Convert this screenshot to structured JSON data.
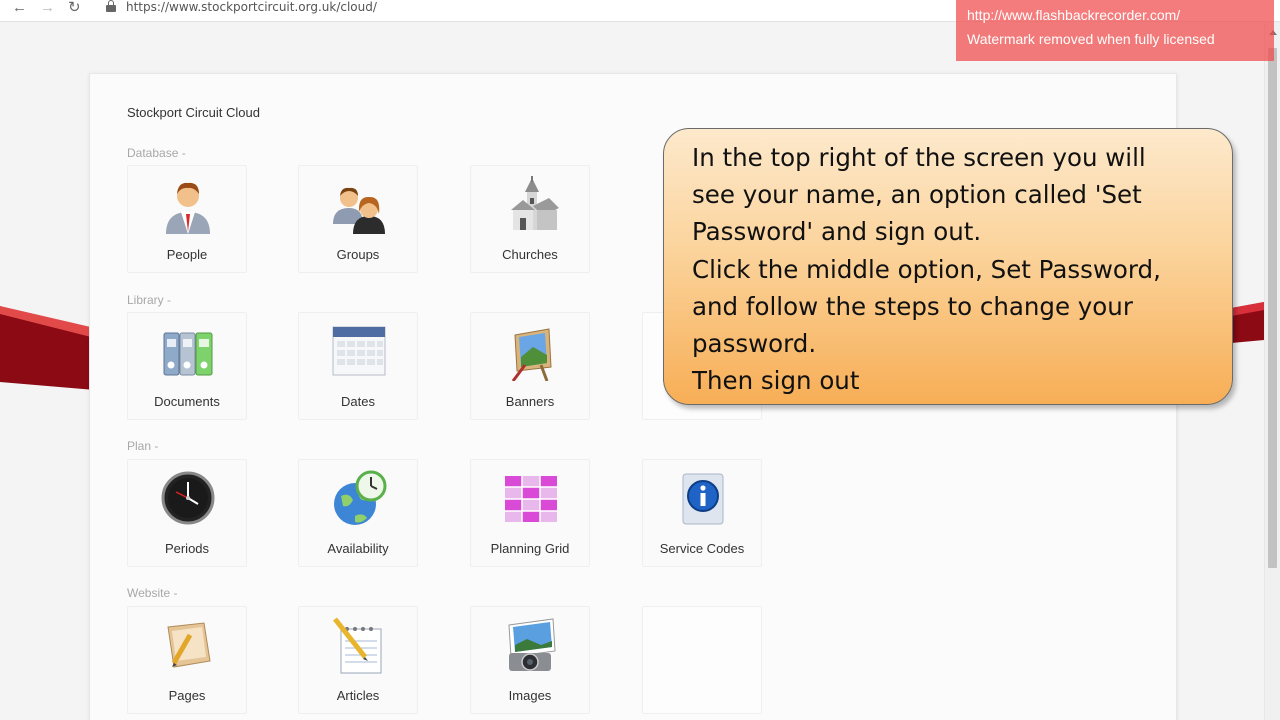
{
  "browser": {
    "url": "https://www.stockportcircuit.org.uk/cloud/"
  },
  "icons": {
    "back": "arrow-left-icon",
    "forward": "arrow-right-icon",
    "reload": "reload-icon",
    "lock": "lock-icon"
  },
  "watermark": {
    "line1": "http://www.flashbackrecorder.com/",
    "line2": "Watermark removed when fully licensed"
  },
  "site": {
    "title": "Stockport Circuit Cloud"
  },
  "sections": [
    {
      "label": "Database -",
      "tiles": [
        "People",
        "Groups",
        "Churches"
      ]
    },
    {
      "label": "Library -",
      "tiles": [
        "Documents",
        "Dates",
        "Banners"
      ]
    },
    {
      "label": "Plan -",
      "tiles": [
        "Periods",
        "Availability",
        "Planning Grid",
        "Service Codes"
      ]
    },
    {
      "label": "Website -",
      "tiles": [
        "Pages",
        "Articles",
        "Images"
      ]
    }
  ],
  "callout": {
    "lines": [
      "In the top right of the screen you will",
      "see your name, an option called 'Set",
      "Password' and sign out.",
      "Click the middle option, Set Password,",
      "and follow the steps to change your",
      "password.",
      "Then sign out"
    ]
  },
  "colors": {
    "callout_top": "#fde9cc",
    "callout_bottom": "#f7ae56",
    "watermark": "#f04a4a",
    "stripe": "#c8101e"
  }
}
